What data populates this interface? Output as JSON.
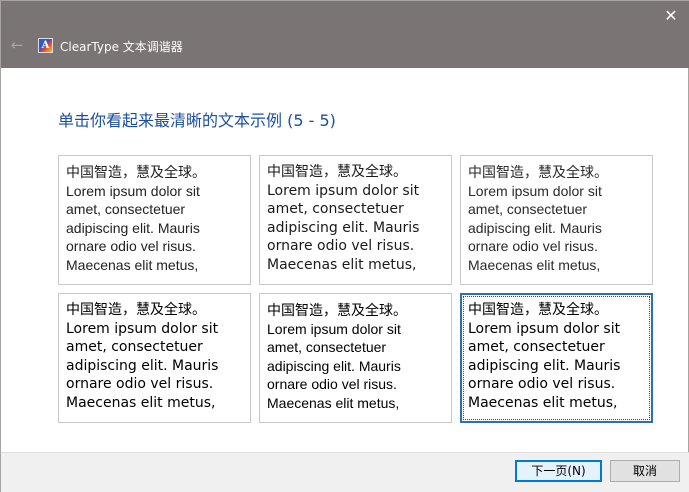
{
  "window": {
    "title": "ClearType 文本调谐器",
    "close_glyph": "✕",
    "back_glyph": "←",
    "app_icon_letter": "A"
  },
  "heading": "单击你看起来最清晰的文本示例 (5 - 5)",
  "samples": [
    {
      "lines": [
        "中国智造，慧及全球。",
        "Lorem ipsum dolor sit",
        "amet, consectetuer",
        "adipiscing elit. Mauris",
        "ornare odio vel risus.",
        "Maecenas elit metus,"
      ]
    },
    {
      "lines": [
        "中国智造，慧及全球。",
        "Lorem ipsum dolor sit",
        "amet, consectetuer",
        "adipiscing elit. Mauris",
        "ornare odio vel risus.",
        "Maecenas elit metus,"
      ]
    },
    {
      "lines": [
        "中国智造，慧及全球。",
        "Lorem ipsum dolor sit",
        "amet, consectetuer",
        "adipiscing elit. Mauris",
        "ornare odio vel risus.",
        "Maecenas elit metus,"
      ]
    },
    {
      "lines": [
        "中国智造，慧及全球。",
        "Lorem ipsum dolor sit",
        "amet, consectetuer",
        "adipiscing elit. Mauris",
        "ornare odio vel risus.",
        "Maecenas elit metus,"
      ]
    },
    {
      "lines": [
        "中国智造，慧及全球。",
        "Lorem ipsum dolor sit",
        "amet, consectetuer",
        "adipiscing elit. Mauris",
        "ornare odio vel risus.",
        "Maecenas elit metus,"
      ]
    },
    {
      "lines": [
        "中国智造，慧及全球。",
        "Lorem ipsum dolor sit",
        "amet, consectetuer",
        "adipiscing elit. Mauris",
        "ornare odio vel risus.",
        "Maecenas elit metus,"
      ]
    }
  ],
  "selected_sample": 6,
  "buttons": {
    "next": "下一页(N)",
    "cancel": "取消"
  },
  "colors": {
    "titlebar": "#7a7474",
    "heading": "#1a4fa0",
    "selection_border": "#2f6fb1",
    "primary_button_border": "#0078d7"
  }
}
